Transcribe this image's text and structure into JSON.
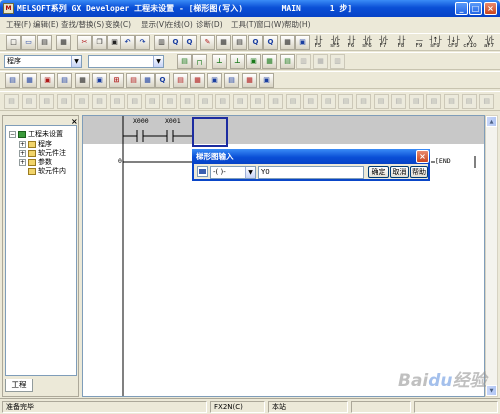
{
  "window": {
    "title": "MELSOFT系列 GX Developer 工程未设置 - [梯形图(写入)        MAIN      1 步]",
    "icon_text": "M"
  },
  "menu": [
    "工程(F)",
    "编辑(E)",
    "查找/替换(S)",
    "变换(C)",
    "显示(V)",
    "在线(O)",
    "诊断(D)",
    "工具(T)",
    "窗口(W)",
    "帮助(H)"
  ],
  "toolbar": {
    "fkeys": [
      {
        "sym": "┤├",
        "label": "F5"
      },
      {
        "sym": "┤/├",
        "label": "sF5"
      },
      {
        "sym": "┤├",
        "label": "F6"
      },
      {
        "sym": "┤/├",
        "label": "sF6"
      },
      {
        "sym": "┤/├",
        "label": "F7"
      },
      {
        "sym": "┤├",
        "label": "F8"
      },
      {
        "sym": "—",
        "label": "F9"
      },
      {
        "sym": "┤↑├",
        "label": "sF9"
      },
      {
        "sym": "┤↓├",
        "label": "cF9"
      },
      {
        "sym": "╳",
        "label": "cF10"
      },
      {
        "sym": "┤/├",
        "label": "aF7"
      }
    ],
    "program_combo": "程序",
    "second_combo": ""
  },
  "project": {
    "close": "×",
    "root": "工程未设置",
    "items": [
      {
        "label": "程序",
        "expand": "+"
      },
      {
        "label": "软元件注",
        "expand": "+"
      },
      {
        "label": "参数",
        "expand": "+"
      },
      {
        "label": "软元件内",
        "expand": ""
      }
    ],
    "tab": "工程"
  },
  "ladder": {
    "contacts": [
      "X000",
      "X001"
    ],
    "step": "0",
    "end": "[END"
  },
  "dialog": {
    "title": "梯形图输入",
    "close": "×",
    "symbol": "-( )-",
    "input_value": "Y0",
    "ok": "确定",
    "cancel": "取消",
    "help": "帮助"
  },
  "status": {
    "ready": "准备完毕",
    "plc": "FX2N(C)",
    "station": "本站"
  },
  "watermark": "Baidu经验"
}
